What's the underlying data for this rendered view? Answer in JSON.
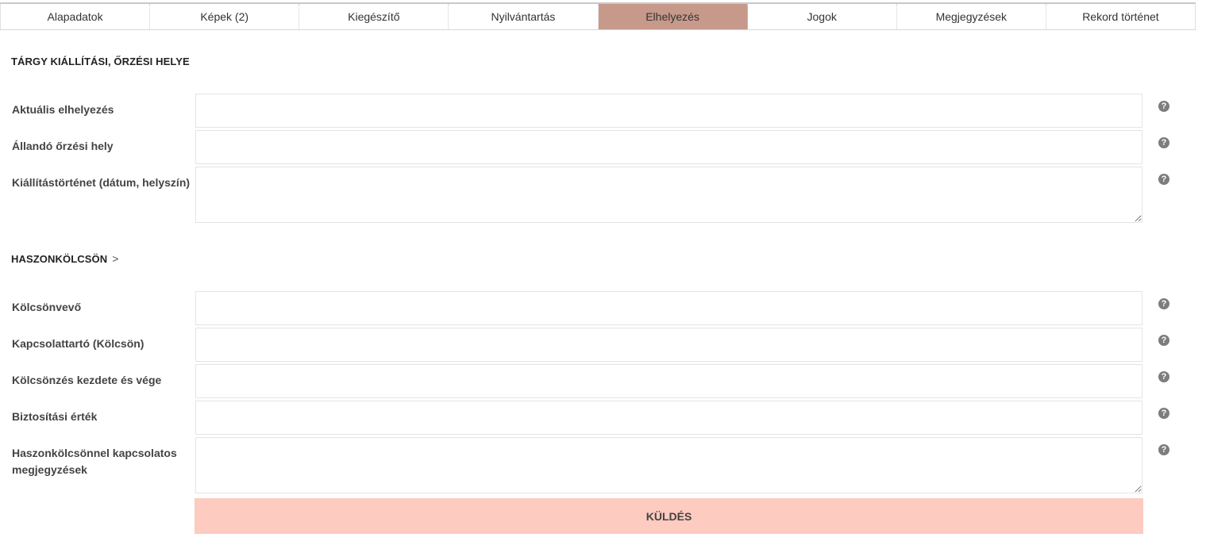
{
  "tabs": [
    {
      "label": "Alapadatok"
    },
    {
      "label": "Képek (2)"
    },
    {
      "label": "Kiegészítő"
    },
    {
      "label": "Nyilvántartás"
    },
    {
      "label": "Elhelyezés",
      "active": true
    },
    {
      "label": "Jogok"
    },
    {
      "label": "Megjegyzések"
    },
    {
      "label": "Rekord történet"
    }
  ],
  "section1": {
    "title": "TÁRGY KIÁLLÍTÁSI, ŐRZÉSI HELYE",
    "fields": [
      {
        "label": "Aktuális elhelyezés",
        "value": ""
      },
      {
        "label": "Állandó őrzési hely",
        "value": ""
      },
      {
        "label": "Kiállítástörténet (dátum, helyszín)",
        "value": ""
      }
    ]
  },
  "section2": {
    "title": "HASZONKÖLCSÖN",
    "chevron": ">",
    "fields": [
      {
        "label": "Kölcsönvevő",
        "value": ""
      },
      {
        "label": "Kapcsolattartó (Kölcsön)",
        "value": ""
      },
      {
        "label": "Kölcsönzés kezdete és vége",
        "value": ""
      },
      {
        "label": "Biztosítási érték",
        "value": ""
      },
      {
        "label": "Haszonkölcsönnel kapcsolatos megjegyzések",
        "value": ""
      }
    ]
  },
  "help_icon": "?",
  "submit_label": "KÜLDÉS",
  "colors": {
    "active_tab": "#c7998a",
    "submit_bg": "#fdcbbf",
    "help_icon_bg": "#7d7d7d"
  }
}
